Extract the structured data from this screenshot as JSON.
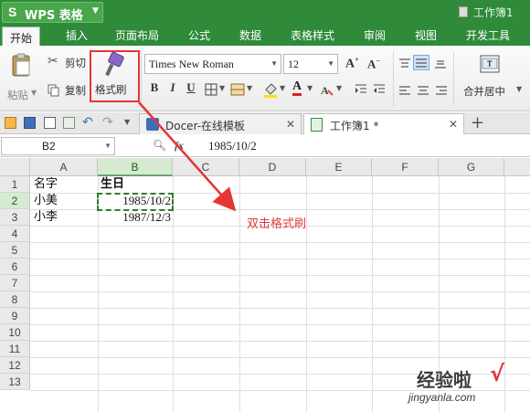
{
  "app": {
    "logo": "S",
    "name": "WPS 表格",
    "doc_title": "工作簿1"
  },
  "ribbon_tabs": [
    "开始",
    "插入",
    "页面布局",
    "公式",
    "数据",
    "表格样式",
    "审阅",
    "视图",
    "开发工具"
  ],
  "clipboard": {
    "paste": "粘贴",
    "cut": "剪切",
    "copy": "复制",
    "format_painter": "格式刷"
  },
  "font": {
    "name": "Times New Roman",
    "size": "12"
  },
  "format_buttons": [
    "B",
    "I",
    "U"
  ],
  "alignment": {
    "merge_center": "合并居中"
  },
  "doc_tabs": [
    {
      "label": "Docer-在线模板"
    },
    {
      "label": "工作簿1 *"
    }
  ],
  "formula_bar": {
    "name_box": "B2",
    "fx": "fx",
    "value": "1985/10/2"
  },
  "columns": [
    "A",
    "B",
    "C",
    "D",
    "E",
    "F",
    "G"
  ],
  "rows": [
    "1",
    "2",
    "3",
    "4",
    "5",
    "6",
    "7",
    "8",
    "9",
    "10",
    "11",
    "12",
    "13"
  ],
  "cells": {
    "A1": "名字",
    "B1": "生日",
    "A2": "小美",
    "B2": "1985/10/2",
    "A3": "小李",
    "B3": "1987/12/3"
  },
  "annotation": "双击格式刷",
  "watermark": {
    "text": "经验啦",
    "check": "√",
    "url": "jingyanla.com"
  },
  "colors": {
    "title_bg": "#2f8a3a",
    "accent_red": "#e53535",
    "selection_green": "#2e7d32"
  }
}
